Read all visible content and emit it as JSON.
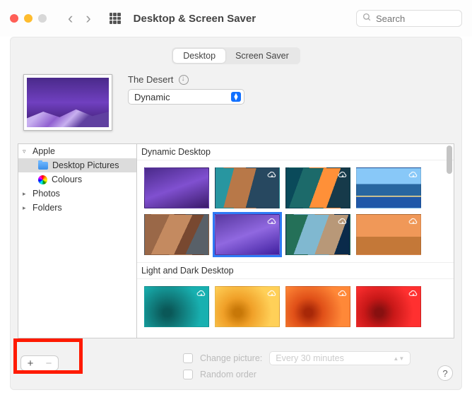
{
  "window": {
    "title": "Desktop & Screen Saver",
    "search_placeholder": "Search"
  },
  "tabs": [
    {
      "label": "Desktop",
      "active": true
    },
    {
      "label": "Screen Saver",
      "active": false
    }
  ],
  "current_wallpaper": {
    "name": "The Desert",
    "mode_selected": "Dynamic"
  },
  "sidebar": {
    "groups": [
      {
        "label": "Apple",
        "expanded": true,
        "items": [
          {
            "label": "Desktop Pictures",
            "icon": "folder",
            "selected": true
          },
          {
            "label": "Colours",
            "icon": "colorwheel",
            "selected": false
          }
        ]
      },
      {
        "label": "Photos",
        "expanded": false,
        "items": []
      },
      {
        "label": "Folders",
        "expanded": false,
        "items": []
      }
    ]
  },
  "gallery": {
    "sections": [
      {
        "label": "Dynamic Desktop",
        "thumbs": [
          {
            "style": "t-purple",
            "cloud": false,
            "selected": false
          },
          {
            "style": "t-cliff",
            "cloud": true,
            "selected": false
          },
          {
            "style": "t-bigsur",
            "cloud": true,
            "selected": false
          },
          {
            "style": "t-catalina",
            "cloud": true,
            "selected": false
          },
          {
            "style": "t-rocks",
            "cloud": false,
            "selected": false
          },
          {
            "style": "t-purple2",
            "cloud": true,
            "selected": true
          },
          {
            "style": "t-beach",
            "cloud": true,
            "selected": false
          },
          {
            "style": "t-sunset",
            "cloud": true,
            "selected": false
          }
        ]
      },
      {
        "label": "Light and Dark Desktop",
        "thumbs": [
          {
            "style": "t-teal",
            "cloud": true,
            "selected": false
          },
          {
            "style": "t-yellow",
            "cloud": true,
            "selected": false
          },
          {
            "style": "t-orange",
            "cloud": true,
            "selected": false
          },
          {
            "style": "t-red",
            "cloud": true,
            "selected": false
          }
        ]
      }
    ]
  },
  "options": {
    "change_picture_label": "Change picture:",
    "change_interval": "Every 30 minutes",
    "random_order_label": "Random order"
  },
  "buttons": {
    "add": "+",
    "remove": "−",
    "help": "?"
  }
}
